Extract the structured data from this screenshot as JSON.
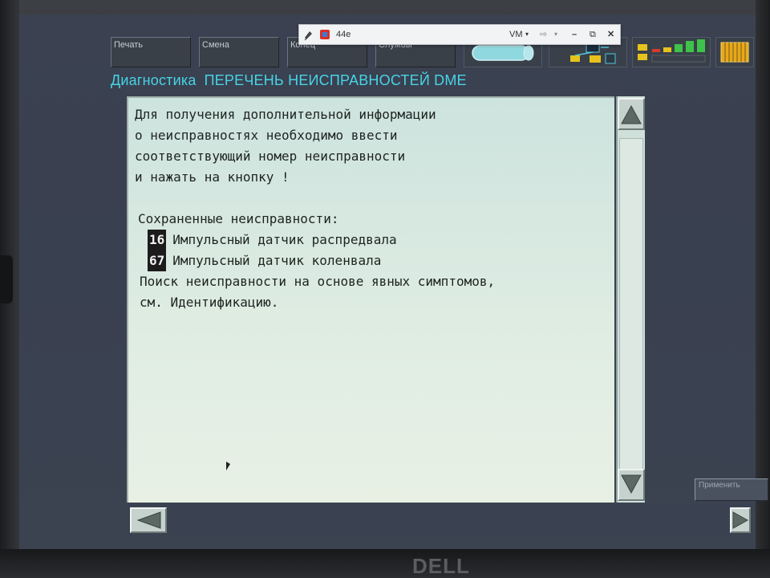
{
  "app": {
    "toolbar": [
      {
        "label": "Печать"
      },
      {
        "label": "Смена"
      },
      {
        "label": "Конец"
      },
      {
        "label": "Службы"
      }
    ],
    "section": "Диагностика",
    "title": "ПЕРЕЧЕНЬ НЕИСПРАВНОСТЕЙ DME"
  },
  "message": {
    "lines": [
      "Для получения дополнительной информации",
      "о неисправностях необходимо ввести",
      "соответствующий номер неисправности",
      "и нажать на кнопку  !"
    ],
    "saved_heading": "Сохраненные неисправности:",
    "faults": [
      {
        "code": "16",
        "text": "Импульсный датчик распредвала"
      },
      {
        "code": "67",
        "text": "Импульсный датчик коленвала"
      }
    ],
    "footer_lines": [
      "Поиск неисправности на основе явных симптомов,",
      "см. Идентификацию."
    ]
  },
  "apply_button": "Применить",
  "vm_bar": {
    "host": "44e",
    "menu": "VM"
  },
  "bezel_logo": "DELL",
  "colors": {
    "title_cyan": "#46d4e6",
    "panel_bg": "#dfece2",
    "screen_bg": "#3b4150",
    "status_green": "#3fc24a",
    "status_red": "#d43b2e",
    "status_yellow": "#e6c21c"
  }
}
